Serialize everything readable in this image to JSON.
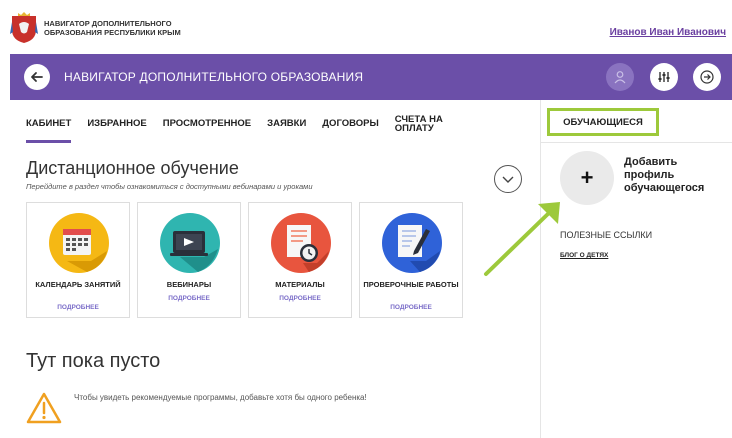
{
  "header": {
    "brand_line1": "НАВИГАТОР ДОПОЛНИТЕЛЬНОГО",
    "brand_line2": "ОБРАЗОВАНИЯ РЕСПУБЛИКИ КРЫМ",
    "user_name": "Иванов Иван Иванович"
  },
  "navbar": {
    "title": "НАВИГАТОР ДОПОЛНИТЕЛЬНОГО ОБРАЗОВАНИЯ",
    "back_icon": "arrow-left-icon",
    "avatar_icon": "user-icon",
    "filter_icon": "filters-icon",
    "exit_icon": "exit-icon",
    "color": "#6b4fa8"
  },
  "tabs": [
    {
      "label": "КАБИНЕТ",
      "active": true
    },
    {
      "label": "ИЗБРАННОЕ"
    },
    {
      "label": "ПРОСМОТРЕННОЕ"
    },
    {
      "label": "ЗАЯВКИ"
    },
    {
      "label": "ДОГОВОРЫ"
    },
    {
      "label": "СЧЕТА НА ОПЛАТУ"
    }
  ],
  "distance": {
    "title": "Дистанционное обучение",
    "subtitle": "Перейдите в раздел чтобы ознакомиться с доступными вебинарами и уроками",
    "cards": [
      {
        "label": "КАЛЕНДАРЬ ЗАНЯТИЙ",
        "more": "ПОДРОБНЕЕ",
        "icon": "calendar-icon",
        "color": "#f5b814"
      },
      {
        "label": "ВЕБИНАРЫ",
        "more": "ПОДРОБНЕЕ",
        "icon": "webinar-icon",
        "color": "#2fb5b0"
      },
      {
        "label": "МАТЕРИАЛЫ",
        "more": "ПОДРОБНЕЕ",
        "icon": "materials-icon",
        "color": "#e8553e"
      },
      {
        "label": "ПРОВЕРОЧНЫЕ РАБОТЫ",
        "more": "ПОДРОБНЕЕ",
        "icon": "tests-icon",
        "color": "#2f62d8"
      }
    ]
  },
  "empty": {
    "title": "Тут пока пусто",
    "text": "Чтобы увидеть рекомендуемые программы, добавьте хотя бы одного ребенка!",
    "icon": "warning-icon"
  },
  "side": {
    "students_tab": "ОБУЧАЮЩИЕСЯ",
    "add_plus": "+",
    "add_text": "Добавить профиль обучающегося",
    "links_title": "ПОЛЕЗНЫЕ ССЫЛКИ",
    "blog_link": "БЛОГ О ДЕТЯХ",
    "highlight_color": "#9dc93b"
  }
}
